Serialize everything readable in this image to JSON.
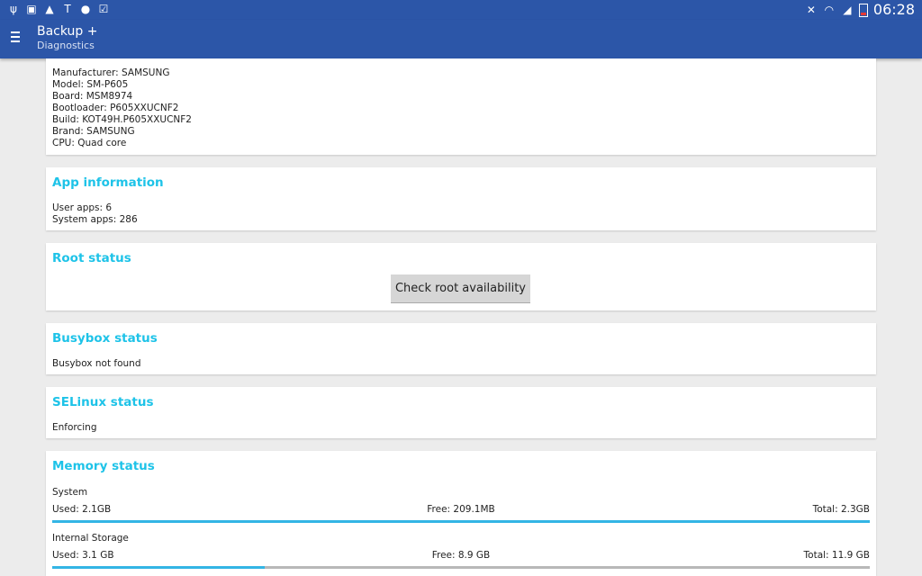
{
  "status_bar": {
    "time": "06:28",
    "left_icons": [
      "usb-icon",
      "debug-icon",
      "warning-icon",
      "news-icon",
      "sync-icon",
      "check-clipboard-icon"
    ],
    "right_icons": [
      "mute-icon",
      "wifi-icon",
      "signal-icon",
      "battery-icon"
    ]
  },
  "app_bar": {
    "title": "Backup +",
    "subtitle": "Diagnostics"
  },
  "device_info": {
    "lines": [
      "Manufacturer: SAMSUNG",
      "Model: SM-P605",
      "Board: MSM8974",
      "Bootloader: P605XXUCNF2",
      "Build: KOT49H.P605XXUCNF2",
      "Brand: SAMSUNG",
      "CPU: Quad core"
    ]
  },
  "app_information": {
    "title": "App information",
    "user_apps": "User apps: 6",
    "system_apps": "System apps: 286"
  },
  "root_status": {
    "title": "Root status",
    "button_label": "Check root availability"
  },
  "busybox_status": {
    "title": "Busybox status",
    "text": "Busybox not found"
  },
  "selinux_status": {
    "title": "SELinux status",
    "text": "Enforcing"
  },
  "memory_status": {
    "title": "Memory status",
    "system": {
      "label": "System",
      "used": "Used: 2.1GB",
      "free": "Free: 209.1MB",
      "total": "Total: 2.3GB",
      "used_fraction": 1.0
    },
    "internal": {
      "label": "Internal Storage",
      "used": "Used: 3.1 GB",
      "free": "Free: 8.9 GB",
      "total": "Total: 11.9 GB",
      "used_fraction": 0.26
    }
  },
  "colors": {
    "app_bar": "#2c56a8",
    "section_title": "#1ec3e8",
    "progress": "#33b5e5"
  }
}
